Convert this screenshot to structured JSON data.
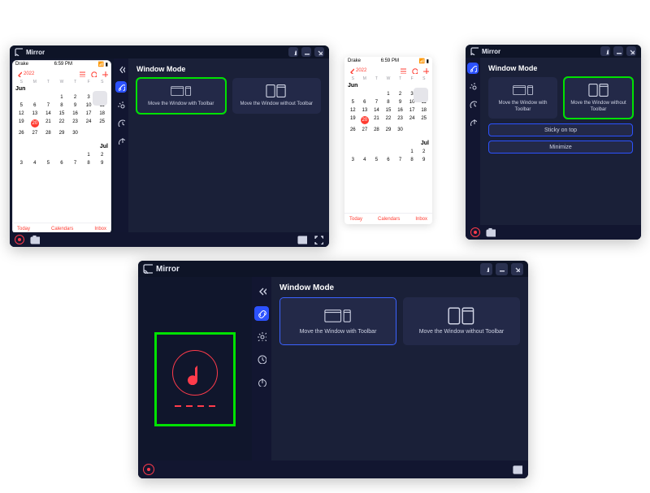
{
  "app": {
    "title": "Mirror"
  },
  "window_controls": {
    "pin": "pin",
    "min": "minimize",
    "close": "close"
  },
  "sidebar": {
    "collapse": "Collapse",
    "items": [
      {
        "id": "window-mode",
        "label": "Window Mode"
      },
      {
        "id": "settings",
        "label": "Settings"
      },
      {
        "id": "history",
        "label": "Recent"
      },
      {
        "id": "power",
        "label": "Shutdown"
      }
    ]
  },
  "panel": {
    "title": "Window Mode",
    "mode_with": "Move the Window\nwith Toolbar",
    "mode_without": "Move the Window\nwithout Toolbar",
    "sticky": "Sticky on top",
    "minimize": "Minimize"
  },
  "phone": {
    "carrier": "Drake",
    "time": "6:59 PM",
    "year": "2022",
    "days": [
      "S",
      "M",
      "T",
      "W",
      "T",
      "F",
      "S"
    ],
    "month1": "Jun",
    "month1_year": "",
    "month2": "Jul",
    "month2_year": "",
    "weeks": [
      [
        "",
        "",
        "",
        "1",
        "2",
        "3",
        "4"
      ],
      [
        "5",
        "6",
        "7",
        "8",
        "9",
        "10",
        "11"
      ],
      [
        "12",
        "13",
        "14",
        "15",
        "16",
        "17",
        "18"
      ],
      [
        "19",
        "20",
        "21",
        "22",
        "23",
        "24",
        "25"
      ],
      [
        "26",
        "27",
        "28",
        "29",
        "30",
        "",
        ""
      ]
    ],
    "jul_row": [
      "",
      "",
      "",
      "",
      "",
      "1",
      "2"
    ],
    "jul_row2": [
      "3",
      "4",
      "5",
      "6",
      "7",
      "8",
      "9"
    ],
    "today": "20",
    "footer": {
      "today": "Today",
      "calendars": "Calendars",
      "inbox": "Inbox"
    }
  },
  "footer_icons": {
    "record": "record",
    "camera": "camera",
    "layout": "layout",
    "expand": "expand"
  }
}
